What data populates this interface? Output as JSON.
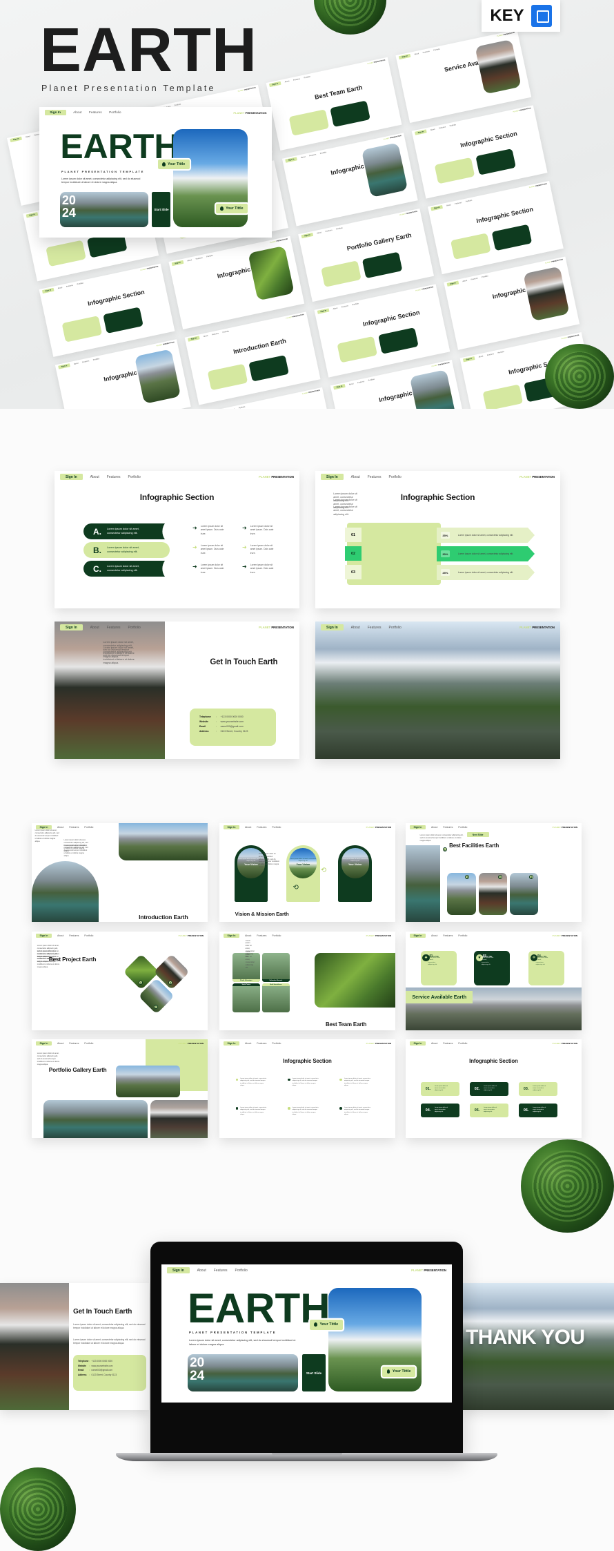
{
  "brand": {
    "title": "EARTH",
    "subtitle": "Planet Presentation Template",
    "format_badge": "KEY",
    "format_icon": "keynote-icon"
  },
  "colors": {
    "dark_green": "#0e3b1f",
    "light_green": "#d5e8a0",
    "bright_green": "#2ecc71",
    "key_blue": "#1a73e8"
  },
  "nav": {
    "sign_in": "Sign In",
    "about": "About",
    "features": "Features",
    "portfolio": "Portfolio",
    "brand_1": "PLANET",
    "brand_2": "PRESENTATION"
  },
  "lorem": {
    "short": "Lorem ipsum dolor sit amet, consectetur adipiscing elit.",
    "long": "Lorem ipsum dolor sit amet, consectetur adipiscing elit, sed do eiusmod tempor incididunt ut labore et dolore magna aliqua.",
    "item": "Lorem ipsum dolor sit amet ipsum. Duis aute irure."
  },
  "cover": {
    "title": "EARTH",
    "subtitle": "PLANET PRESENTATION TEMPLATE",
    "body": "Lorem ipsum dolor sit amet, consectetur adipiscing elit, sed do eiusmod tempor incididunt ut labore et dolore magna aliqua.",
    "year_1": "20",
    "year_2": "24",
    "start": "Start Slide",
    "tag_1": "Your Tittle",
    "tag_2": "Your Tittle"
  },
  "mosaic": [
    "Vision & Mission Earth",
    "Best Project Earth",
    "Best Team Earth",
    "Service Available Earth",
    "Infographic Section",
    "Introduction Earth",
    "Infographic Section",
    "Infographic Section",
    "Infographic Section",
    "Infographic Section",
    "Portfolio Gallery Earth",
    "Infographic Section",
    "Infographic Section",
    "Introduction Earth",
    "Infographic Section",
    "Infographic Section",
    "Infographic Section",
    "Infographic Section",
    "Infographic Section",
    "Infographic Section"
  ],
  "slides": {
    "abc": {
      "title": "Infographic Section",
      "items": [
        "A.",
        "B.",
        "C."
      ]
    },
    "bars": {
      "title": "Infographic Section",
      "numbers": [
        "01",
        "02",
        "03"
      ],
      "percents": [
        "35%",
        "30%",
        "45%"
      ]
    },
    "contact": {
      "title": "Get In Touch Earth",
      "rows": [
        {
          "label": "Telephone",
          "value": "+123 0000 0000 0000"
        },
        {
          "label": "Website",
          "value": "www.yourwebsite.com"
        },
        {
          "label": "Email",
          "value": "name000@gmail.com"
        },
        {
          "label": "Address",
          "value": "0123 Street, Country 0123"
        }
      ]
    },
    "thanks": {
      "title": "THANK YOU"
    },
    "intro": {
      "title": "Introduction Earth"
    },
    "vision": {
      "title": "Vision & Mission Earth",
      "card": "Your Vision"
    },
    "facilities": {
      "title": "Best Facilities Earth",
      "button": "Next Slide",
      "badges": [
        "1",
        "2",
        "3",
        "4"
      ]
    },
    "project": {
      "title": "Best Project Earth",
      "badges": [
        "1",
        "2",
        "3"
      ]
    },
    "team": {
      "title": "Best Team Earth",
      "members": [
        "Phylis Schwaiger",
        "Sebastian Bennett",
        "Yanie Petrus",
        "Rahil Hendriksen"
      ]
    },
    "service": {
      "title": "Service Available Earth",
      "cards": [
        {
          "num": "01",
          "label": "Service Title"
        },
        {
          "num": "02",
          "label": "Service Title"
        },
        {
          "num": "04",
          "label": "Service Title"
        }
      ]
    },
    "portfolio": {
      "title": "Portfolio Gallery Earth"
    },
    "info6": {
      "title": "Infographic Section"
    },
    "info_boxes": {
      "title": "Infographic Section",
      "numbers": [
        "01.",
        "02.",
        "03.",
        "04.",
        "05.",
        "06."
      ]
    }
  }
}
